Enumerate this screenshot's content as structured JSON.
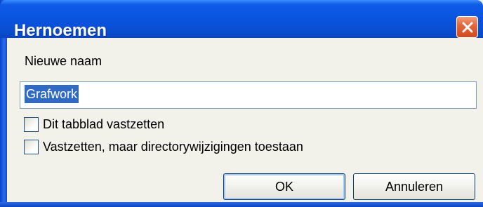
{
  "window": {
    "title": "Hernoemen"
  },
  "dialog": {
    "name_label": "Nieuwe naam",
    "name_value": "Grafwork",
    "checkboxes": [
      {
        "label": "Dit tabblad vastzetten",
        "checked": false
      },
      {
        "label": "Vastzetten, maar directorywijzigingen toestaan",
        "checked": false
      }
    ],
    "ok_label": "OK",
    "cancel_label": "Annuleren"
  },
  "colors": {
    "titlebar": "#0a55e0",
    "close_button": "#e4683c",
    "selection": "#316ac5",
    "client_bg": "#f2f1ea"
  },
  "icons": {
    "close": "close-icon"
  }
}
